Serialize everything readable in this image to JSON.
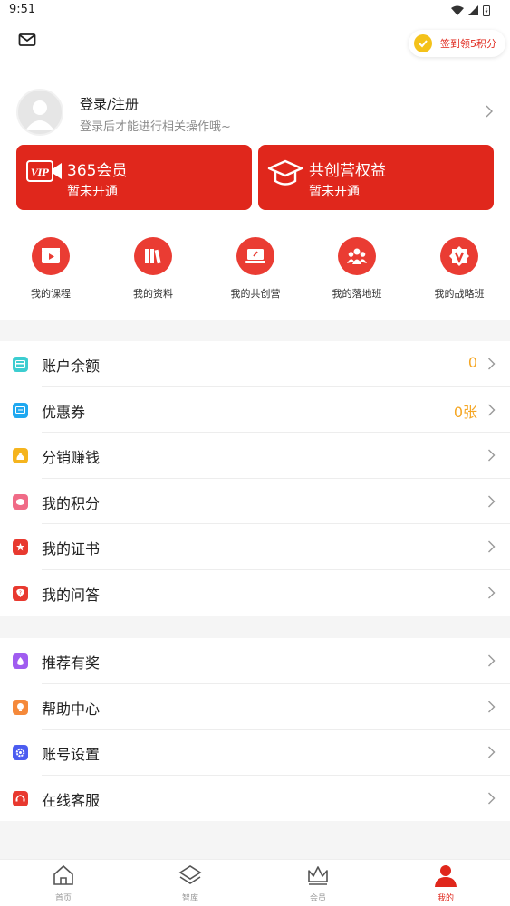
{
  "status_bar": {
    "time": "9:51"
  },
  "header": {
    "signin_label": "签到领5积分"
  },
  "profile": {
    "title": "登录/注册",
    "subtitle": "登录后才能进行相关操作哦~"
  },
  "member_cards": [
    {
      "title": "365会员",
      "status": "暂未开通",
      "icon": "vip-camera-icon"
    },
    {
      "title": "共创营权益",
      "status": "暂未开通",
      "icon": "graduation-cap-icon"
    }
  ],
  "shortcuts": [
    {
      "label": "我的课程",
      "icon": "video-icon"
    },
    {
      "label": "我的资料",
      "icon": "books-icon"
    },
    {
      "label": "我的共创营",
      "icon": "laptop-icon"
    },
    {
      "label": "我的落地班",
      "icon": "group-icon"
    },
    {
      "label": "我的战略班",
      "icon": "v-badge-icon"
    }
  ],
  "menu_group_1": [
    {
      "label": "账户余额",
      "value": "0",
      "icon": "wallet-icon",
      "color": "#3ccdd0"
    },
    {
      "label": "优惠券",
      "value": "0张",
      "icon": "ticket-icon",
      "color": "#1fa8f0"
    },
    {
      "label": "分销赚钱",
      "value": "",
      "icon": "money-bag-icon",
      "color": "#f5b41e"
    },
    {
      "label": "我的积分",
      "value": "",
      "icon": "points-icon",
      "color": "#f06b87"
    },
    {
      "label": "我的证书",
      "value": "",
      "icon": "certificate-icon",
      "color": "#e8392f"
    },
    {
      "label": "我的问答",
      "value": "",
      "icon": "question-icon",
      "color": "#e8392f"
    }
  ],
  "menu_group_2": [
    {
      "label": "推荐有奖",
      "value": "",
      "icon": "gift-drop-icon",
      "color": "#a05cf0"
    },
    {
      "label": "帮助中心",
      "value": "",
      "icon": "lightbulb-icon",
      "color": "#f5893a"
    },
    {
      "label": "账号设置",
      "value": "",
      "icon": "settings-icon",
      "color": "#4b5cf0"
    },
    {
      "label": "在线客服",
      "value": "",
      "icon": "headset-icon",
      "color": "#e8392f"
    }
  ],
  "bottom_nav": [
    {
      "label": "首页",
      "icon": "home-icon"
    },
    {
      "label": "智库",
      "icon": "layers-icon"
    },
    {
      "label": "会员",
      "icon": "crown-icon"
    },
    {
      "label": "我的",
      "icon": "user-icon",
      "active": true
    }
  ]
}
